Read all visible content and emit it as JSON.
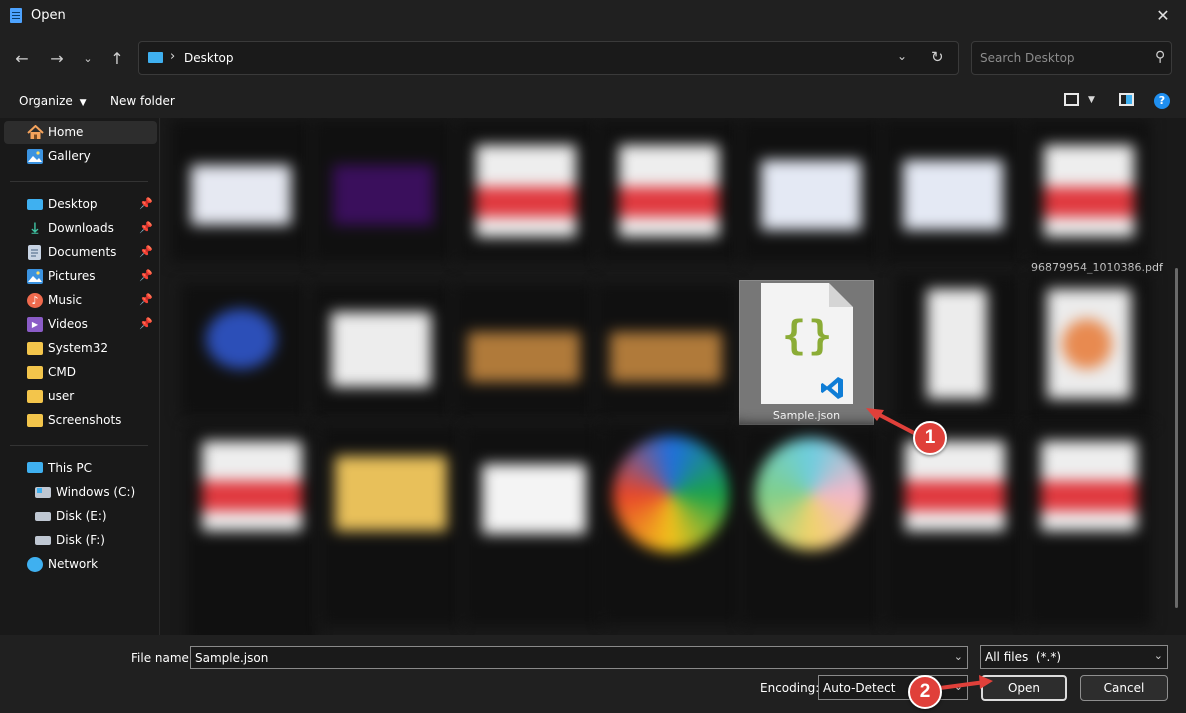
{
  "window": {
    "title": "Open"
  },
  "nav": {
    "address": {
      "location": "Desktop"
    },
    "search_placeholder": "Search Desktop"
  },
  "toolbar": {
    "organize": "Organize",
    "new_folder": "New folder"
  },
  "sidebar": {
    "items": [
      {
        "label": "Home",
        "icon": "home-icon",
        "selected": true
      },
      {
        "label": "Gallery",
        "icon": "gallery-icon"
      },
      {
        "label": "Desktop",
        "icon": "desktop-icon",
        "pinned": true
      },
      {
        "label": "Downloads",
        "icon": "download-icon",
        "pinned": true
      },
      {
        "label": "Documents",
        "icon": "documents-icon",
        "pinned": true
      },
      {
        "label": "Pictures",
        "icon": "pictures-icon",
        "pinned": true
      },
      {
        "label": "Music",
        "icon": "music-icon",
        "pinned": true
      },
      {
        "label": "Videos",
        "icon": "videos-icon",
        "pinned": true
      },
      {
        "label": "System32",
        "icon": "folder-icon"
      },
      {
        "label": "CMD",
        "icon": "folder-icon"
      },
      {
        "label": "user",
        "icon": "folder-icon"
      },
      {
        "label": "Screenshots",
        "icon": "folder-icon"
      },
      {
        "label": "This PC",
        "icon": "computer-icon"
      },
      {
        "label": "Windows (C:)",
        "icon": "drive-icon"
      },
      {
        "label": "Disk (E:)",
        "icon": "drive-icon"
      },
      {
        "label": "Disk (F:)",
        "icon": "drive-icon"
      },
      {
        "label": "Network",
        "icon": "network-icon"
      }
    ]
  },
  "files": {
    "visible_name": "96879954_1010386.pdf",
    "selected": {
      "name": "Sample.json",
      "icon": "json-file-icon"
    }
  },
  "bottom": {
    "file_name_label": "File name:",
    "file_name_value": "Sample.json",
    "file_type": "All files  (*.*)",
    "encoding_label": "Encoding:",
    "encoding_value": "Auto-Detect",
    "open_label": "Open",
    "cancel_label": "Cancel"
  },
  "annotations": [
    {
      "number": "1"
    },
    {
      "number": "2"
    }
  ],
  "colors": {
    "badge": "#e0403a",
    "accent": "#4da3ff",
    "json_braces": "#8bac36",
    "vscode": "#0f7dd6"
  }
}
